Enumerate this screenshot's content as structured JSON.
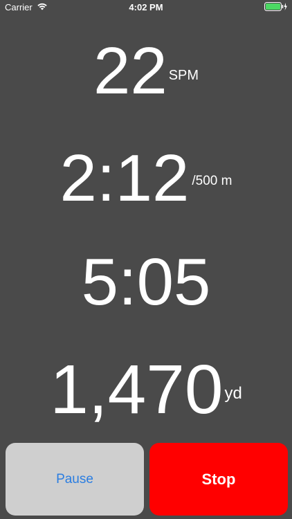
{
  "status_bar": {
    "carrier": "Carrier",
    "time": "4:02 PM",
    "wifi_icon": "wifi-icon",
    "battery_icon": "battery-charging-icon",
    "battery_color": "#4cd964"
  },
  "metrics": {
    "stroke_rate": {
      "value": "22",
      "unit": "SPM"
    },
    "pace": {
      "value": "2:12",
      "unit": "/500 m"
    },
    "elapsed_time": {
      "value": "5:05"
    },
    "distance": {
      "value": "1,470",
      "unit": "yd"
    }
  },
  "buttons": {
    "pause_label": "Pause",
    "stop_label": "Stop"
  },
  "colors": {
    "background": "#4a4a4a",
    "pause_bg": "#cfcfcf",
    "pause_text": "#2a7de1",
    "stop_bg": "#ff0000"
  }
}
